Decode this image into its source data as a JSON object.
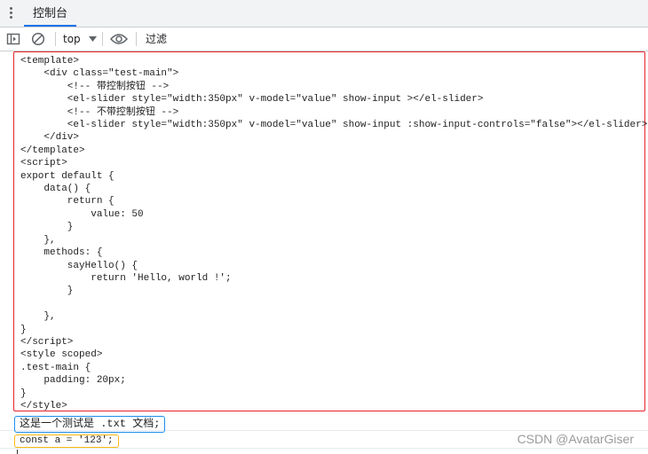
{
  "tabs": [
    {
      "label": "控制台",
      "active": true
    }
  ],
  "toolbar": {
    "context": "top",
    "filter_placeholder": "过滤"
  },
  "icons": [
    "more-vert-icon",
    "sidebar-toggle-icon",
    "clear-console-icon",
    "dropdown-arrow-icon",
    "eye-icon"
  ],
  "console": {
    "code_block": "<template>\n    <div class=\"test-main\">\n        <!-- 带控制按钮 -->\n        <el-slider style=\"width:350px\" v-model=\"value\" show-input ></el-slider>\n        <!-- 不带控制按钮 -->\n        <el-slider style=\"width:350px\" v-model=\"value\" show-input :show-input-controls=\"false\"></el-slider>\n    </div>\n</template>\n<script>\nexport default {\n    data() {\n        return {\n            value: 50\n        }\n    },\n    methods: {\n        sayHello() {\n            return 'Hello, world !';\n        }\n\n    },\n}\n</script>\n<style scoped>\n.test-main {\n    padding: 20px;\n}\n</style>",
    "line2": "这是一个测试是 .txt 文档;",
    "line3": "const a = '123';"
  },
  "watermark": "CSDN @AvatarGiser",
  "colors": {
    "accent": "#1a73e8",
    "red_border": "#e8222a",
    "blue_border": "#1a8ff0",
    "yellow_border": "#fbb917"
  }
}
